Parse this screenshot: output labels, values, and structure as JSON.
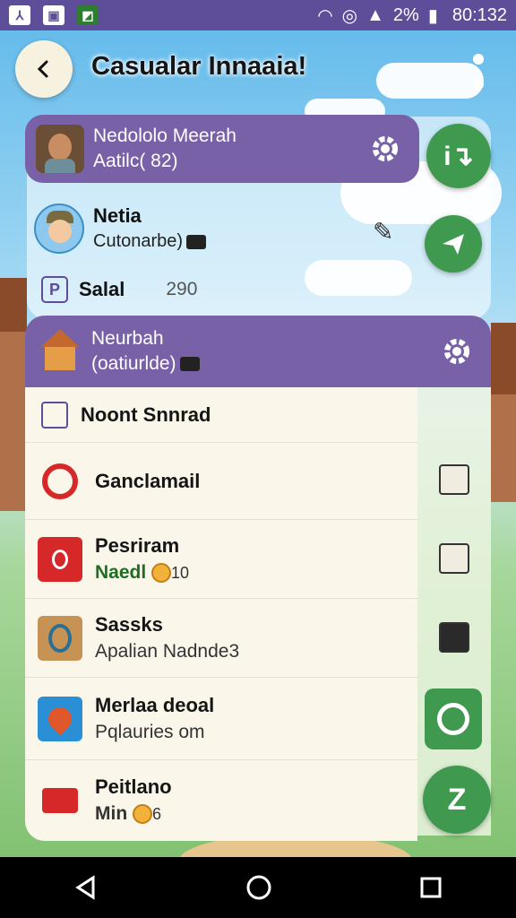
{
  "status_bar": {
    "battery": "2%",
    "time": "80:132"
  },
  "header": {
    "title": "Casualar Innaaia!"
  },
  "profile_banner": {
    "name": "Nedololo Meerah",
    "subtitle": "Aatilc( 82)"
  },
  "contact": {
    "name": "Netia",
    "status": "Cutonarbe)"
  },
  "stat_row": {
    "label": "Salal",
    "value": "290"
  },
  "section_banner": {
    "title": "Neurbah",
    "subtitle": "(oatiurlde)"
  },
  "list": {
    "header": "Noont Snnrad",
    "items": [
      {
        "title": "Ganclamail",
        "subtitle": ""
      },
      {
        "title": "Pesriram",
        "subtitle": "Naedl",
        "badge": "10"
      },
      {
        "title": "Sassks",
        "subtitle": "Apalian Nadnde3"
      },
      {
        "title": "Merlaa deoal",
        "subtitle": "Pqlauries om"
      },
      {
        "title": "Peitlano",
        "subtitle": "Min",
        "badge": "6"
      }
    ]
  },
  "colors": {
    "accent": "#7961a7",
    "status_bar": "#5e4d99",
    "fab": "#3f9a4f"
  }
}
